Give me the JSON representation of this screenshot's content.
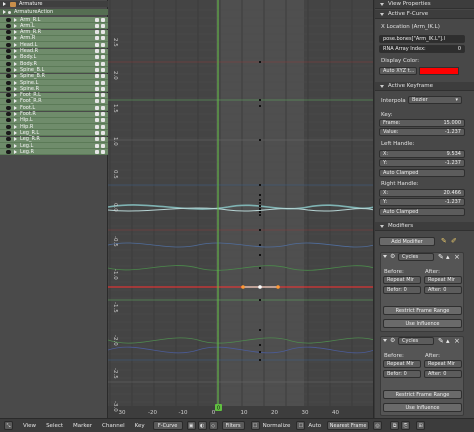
{
  "channels": {
    "armature_label": "Armature",
    "action_label": "ArmatureAction",
    "groups": [
      "Arm_R.L",
      "Arm.L",
      "Arm_R.R",
      "Arm.R",
      "Head.L",
      "Head.R",
      "Body.L",
      "Body.R",
      "Spine_B.L",
      "Spine_B.R",
      "Spine.L",
      "Spine.R",
      "Foot_R.L",
      "Foot_R.R",
      "Foot.L",
      "Foot.R",
      "Hip.L",
      "Hip.R",
      "Leg_R.L",
      "Leg_R.R",
      "Leg.L",
      "Leg.R"
    ]
  },
  "graph": {
    "y_ticks": [
      "2.5",
      "2.0",
      "1.5",
      "1.0",
      "0.5",
      "0.0",
      "-0.5",
      "-1.0",
      "-1.5",
      "-2.0",
      "-2.5",
      "-3.0"
    ],
    "x_ticks": [
      "30",
      "-20",
      "-10",
      "0",
      "10",
      "20",
      "30",
      "40"
    ],
    "current_frame": "0"
  },
  "props": {
    "view_properties": "View Properties",
    "active_fcurve": "Active F-Curve",
    "fcurve_name": "X Location (Arm_IK.L)",
    "data_path": "pose.bones[\"Arm_IK.L\"].l",
    "rna_index": "RNA Array Index:",
    "rna_index_value": "0",
    "display_color": "Display Color:",
    "color_mode": "Auto XYZ t...",
    "color_hex": "#ff0000",
    "active_keyframe": "Active Keyframe",
    "interpolation_label": "Interpola",
    "interpolation_value": "Bezier",
    "key_label": "Key:",
    "frame_label": "Frame:",
    "frame_value": "15.000",
    "value_label": "Value:",
    "value_value": "-1.237",
    "left_handle": "Left Handle:",
    "lh_x_label": "X:",
    "lh_x_value": "9.534",
    "lh_y_label": "Y:",
    "lh_y_value": "-1.237",
    "lh_type": "Auto Clamped",
    "right_handle": "Right Handle:",
    "rh_x_label": "X:",
    "rh_x_value": "20.466",
    "rh_y_label": "Y:",
    "rh_y_value": "-1.237",
    "rh_type": "Auto Clamped",
    "modifiers": "Modifiers",
    "add_modifier": "Add Modifier",
    "cycles": [
      {
        "name": "Cycles",
        "before": "Before:",
        "after": "After:",
        "before_mode": "Repeat Mir",
        "after_mode": "Repeat Mir",
        "before_count": "Befor: 0",
        "after_count": "After: 0",
        "restrict": "Restrict Frame Range",
        "influence": "Use Influence"
      },
      {
        "name": "Cycles",
        "before": "Before:",
        "after": "After:",
        "before_mode": "Repeat Mir",
        "after_mode": "Repeat Mir",
        "before_count": "Befor: 0",
        "after_count": "After: 0",
        "restrict": "Restrict Frame Range",
        "influence": "Use Influence"
      }
    ]
  },
  "bottom": {
    "menus": [
      "View",
      "Select",
      "Marker",
      "Channel",
      "Key"
    ],
    "editor_type": "F-Curve",
    "filters": "Filters",
    "normalize": "Normalize",
    "auto": "Auto",
    "snap_mode": "Nearest Frame"
  }
}
